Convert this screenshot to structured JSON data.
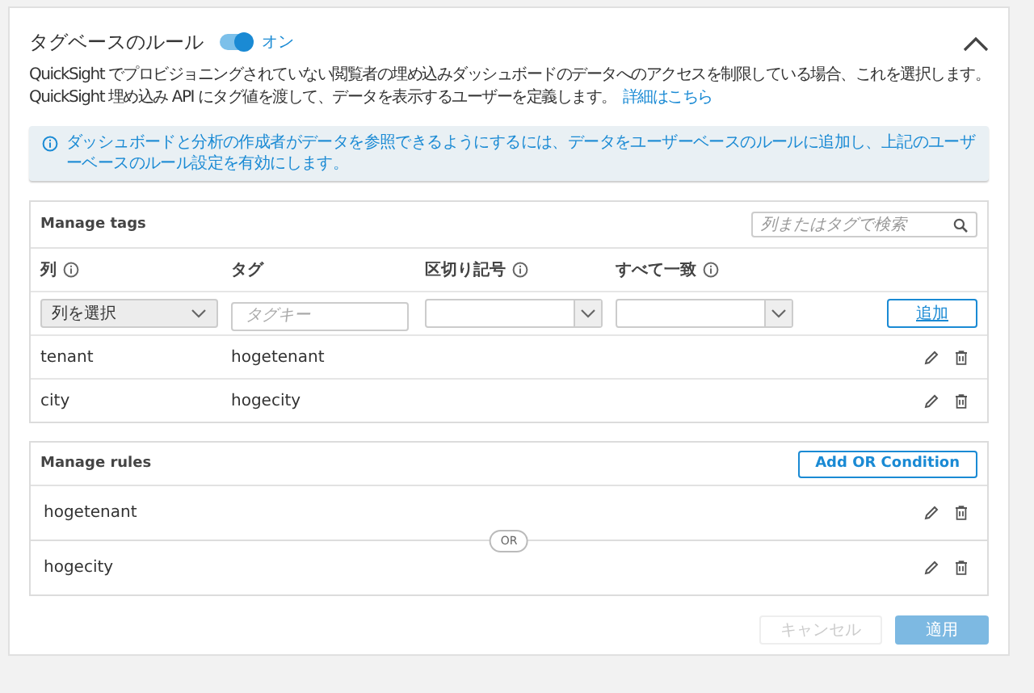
{
  "section": {
    "title": "タグベースのルール",
    "toggle": {
      "on": true,
      "label": "オン"
    },
    "expanded": true
  },
  "description": [
    "QuickSight でプロビジョニングされていない閲覧者の埋め込みダッシュボードのデータへのアクセスを制限している場合、これを選択します。",
    "QuickSight 埋め込み API にタグ値を渡して、データを表示するユーザーを定義します。"
  ],
  "learn_more_link": "詳細はこちら",
  "info": "ダッシュボードと分析の作成者がデータを参照できるようにするには、データをユーザーベースのルールに追加し、上記のユーザーベースのルール設定を有効にします。",
  "manage_tags": {
    "title": "Manage tags",
    "search": {
      "placeholder": "列またはタグで検索"
    },
    "columns": [
      {
        "label": "列",
        "info": true
      },
      {
        "label": "タグ",
        "info": false
      },
      {
        "label": "区切り記号",
        "info": true
      },
      {
        "label": "すべて一致",
        "info": true
      }
    ],
    "column_select": "列を選択",
    "tag_placeholder": "タグキー",
    "add_button": "追加",
    "rows": [
      {
        "column": "tenant",
        "tag": "hogetenant"
      },
      {
        "column": "city",
        "tag": "hogecity"
      }
    ]
  },
  "manage_rules": {
    "title": "Manage rules",
    "add_button": "Add OR Condition",
    "separator": "OR",
    "rules": [
      "hogetenant",
      "hogecity"
    ]
  },
  "buttons": [
    {
      "label": "キャンセル",
      "kind": "secondary",
      "disabled": true
    },
    {
      "label": "適用",
      "kind": "primary",
      "disabled": true
    }
  ]
}
